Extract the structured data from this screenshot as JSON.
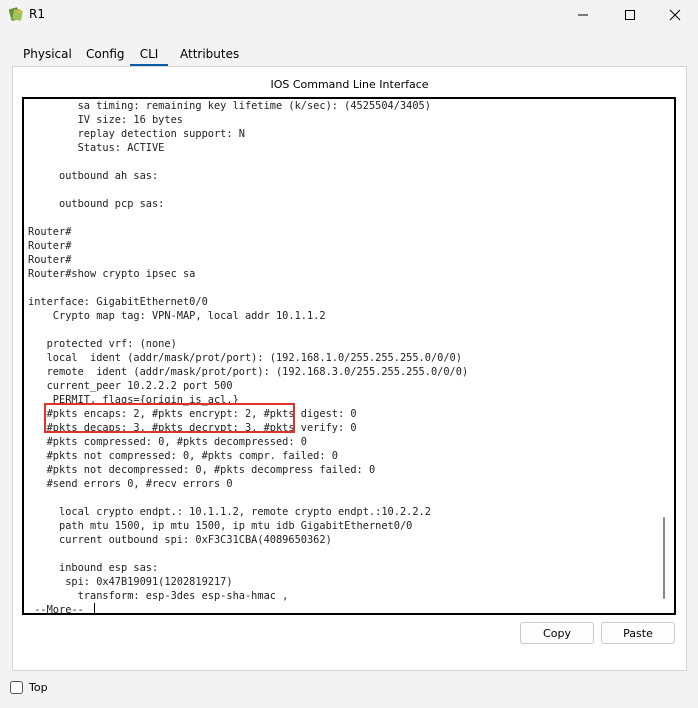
{
  "window": {
    "title": "R1",
    "icon": "router-app-icon"
  },
  "tabs": [
    {
      "label": "Physical",
      "active": false
    },
    {
      "label": "Config",
      "active": false
    },
    {
      "label": "CLI",
      "active": true
    },
    {
      "label": "Attributes",
      "active": false
    }
  ],
  "cli": {
    "heading": "IOS Command Line Interface",
    "lines": [
      "        sa timing: remaining key lifetime (k/sec): (4525504/3405)",
      "        IV size: 16 bytes",
      "        replay detection support: N",
      "        Status: ACTIVE",
      "",
      "     outbound ah sas:",
      "",
      "     outbound pcp sas:",
      "",
      "Router#",
      "Router#",
      "Router#",
      "Router#show crypto ipsec sa",
      "",
      "interface: GigabitEthernet0/0",
      "    Crypto map tag: VPN-MAP, local addr 10.1.1.2",
      "",
      "   protected vrf: (none)",
      "   local  ident (addr/mask/prot/port): (192.168.1.0/255.255.255.0/0/0)",
      "   remote  ident (addr/mask/prot/port): (192.168.3.0/255.255.255.0/0/0)",
      "   current_peer 10.2.2.2 port 500",
      "    PERMIT, flags={origin_is_acl,}",
      "   #pkts encaps: 2, #pkts encrypt: 2, #pkts digest: 0",
      "   #pkts decaps: 3, #pkts decrypt: 3, #pkts verify: 0",
      "   #pkts compressed: 0, #pkts decompressed: 0",
      "   #pkts not compressed: 0, #pkts compr. failed: 0",
      "   #pkts not decompressed: 0, #pkts decompress failed: 0",
      "   #send errors 0, #recv errors 0",
      "",
      "     local crypto endpt.: 10.1.1.2, remote crypto endpt.:10.2.2.2",
      "     path mtu 1500, ip mtu 1500, ip mtu idb GigabitEthernet0/0",
      "     current outbound spi: 0xF3C31CBA(4089650362)",
      "",
      "     inbound esp sas:",
      "      spi: 0x47B19091(1202819217)",
      "        transform: esp-3des esp-sha-hmac ,"
    ],
    "prompt": " --More-- "
  },
  "buttons": {
    "copy": "Copy",
    "paste": "Paste"
  },
  "footer": {
    "top_label": "Top",
    "top_checked": false
  },
  "colors": {
    "active_tab_underline": "#0a5ba8",
    "highlight_border": "#e0322b"
  }
}
